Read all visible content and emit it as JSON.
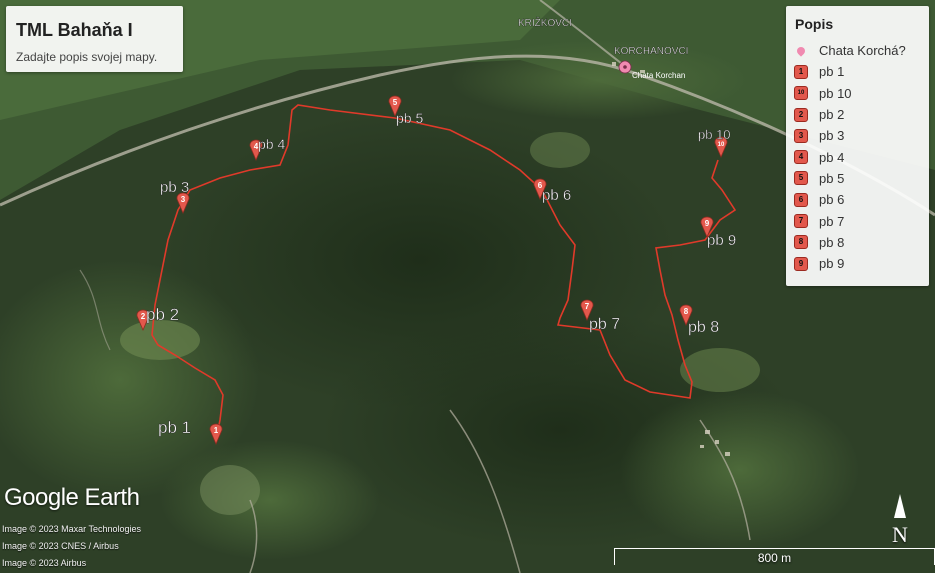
{
  "title_card": {
    "title": "TML Bahaňa I",
    "description": "Zadajte popis svojej mapy."
  },
  "legend": {
    "heading": "Popis",
    "items": [
      {
        "label": "Chata Korchá?",
        "icon": "poi-pin"
      },
      {
        "label": "pb 1",
        "num": "1"
      },
      {
        "label": "pb 10",
        "num": "10"
      },
      {
        "label": "pb 2",
        "num": "2"
      },
      {
        "label": "pb 3",
        "num": "3"
      },
      {
        "label": "pb 4",
        "num": "4"
      },
      {
        "label": "pb 5",
        "num": "5"
      },
      {
        "label": "pb 6",
        "num": "6"
      },
      {
        "label": "pb 7",
        "num": "7"
      },
      {
        "label": "pb 8",
        "num": "8"
      },
      {
        "label": "pb 9",
        "num": "9"
      }
    ]
  },
  "places": {
    "village_1": "KRIŽKOVCI",
    "village_2": "KORCHANOVCI",
    "poi": "Chata Korchan"
  },
  "waypoints": [
    {
      "label": "pb 1",
      "num": "1"
    },
    {
      "label": "pb 2",
      "num": "2"
    },
    {
      "label": "pb 3",
      "num": "3"
    },
    {
      "label": "pb 4",
      "num": "4"
    },
    {
      "label": "pb 5",
      "num": "5"
    },
    {
      "label": "pb 6",
      "num": "6"
    },
    {
      "label": "pb 7",
      "num": "7"
    },
    {
      "label": "pb 8",
      "num": "8"
    },
    {
      "label": "pb 9",
      "num": "9"
    },
    {
      "label": "pb 10",
      "num": "10"
    }
  ],
  "branding": {
    "logo": "Google Earth"
  },
  "credits": [
    "Image © 2023 Maxar Technologies",
    "Image © 2023 CNES / Airbus",
    "Image © 2023 Airbus"
  ],
  "scale": {
    "label": "800 m"
  },
  "compass": {
    "label": "N"
  },
  "colors": {
    "route": "#e03a2a",
    "marker": "#e2584c",
    "poi": "#f08ab0"
  }
}
